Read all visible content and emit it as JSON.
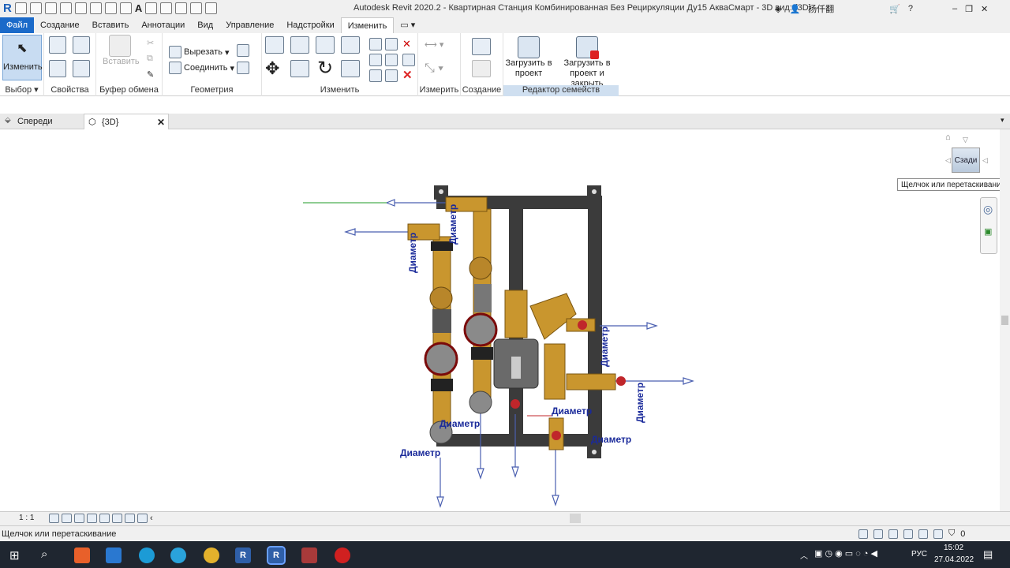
{
  "app": {
    "title": "Autodesk Revit 2020.2 - Квартирная Станция Комбинированная Без Рециркуляции Ду15 АкваСмарт - 3D вид: {3D}",
    "user": "杨仟翻"
  },
  "menu": {
    "tabs": [
      "Файл",
      "Создание",
      "Вставить",
      "Аннотации",
      "Вид",
      "Управление",
      "Надстройки",
      "Изменить"
    ],
    "active": "Изменить"
  },
  "ribbon": {
    "modify_label": "Изменить",
    "select_label": "Выбор",
    "properties_label": "Свойства",
    "paste_label": "Вставить",
    "clipboard_label": "Буфер обмена",
    "cut_label": "Вырезать",
    "join_label": "Соединить",
    "geometry_label": "Геометрия",
    "modify_panel_label": "Изменить",
    "measure_label": "Измерить",
    "create_label": "Создание",
    "load_project_label": "Загрузить в проект",
    "load_project_close_label": "Загрузить в проект и закрыть",
    "family_editor_label": "Редактор семейств"
  },
  "views": {
    "tab1": "Спереди",
    "tab2": "{3D}"
  },
  "canvas": {
    "dimension_label": "Диаметр"
  },
  "viewcube": {
    "face": "Сзади",
    "tooltip": "Щелчок или перетаскивание"
  },
  "viewbar": {
    "scale": "1 : 1"
  },
  "status": {
    "text": "Щелчок или перетаскивание",
    "filter_count": "0"
  },
  "taskbar": {
    "lang": "РУС",
    "time": "15:02",
    "date": "27.04.2022"
  }
}
